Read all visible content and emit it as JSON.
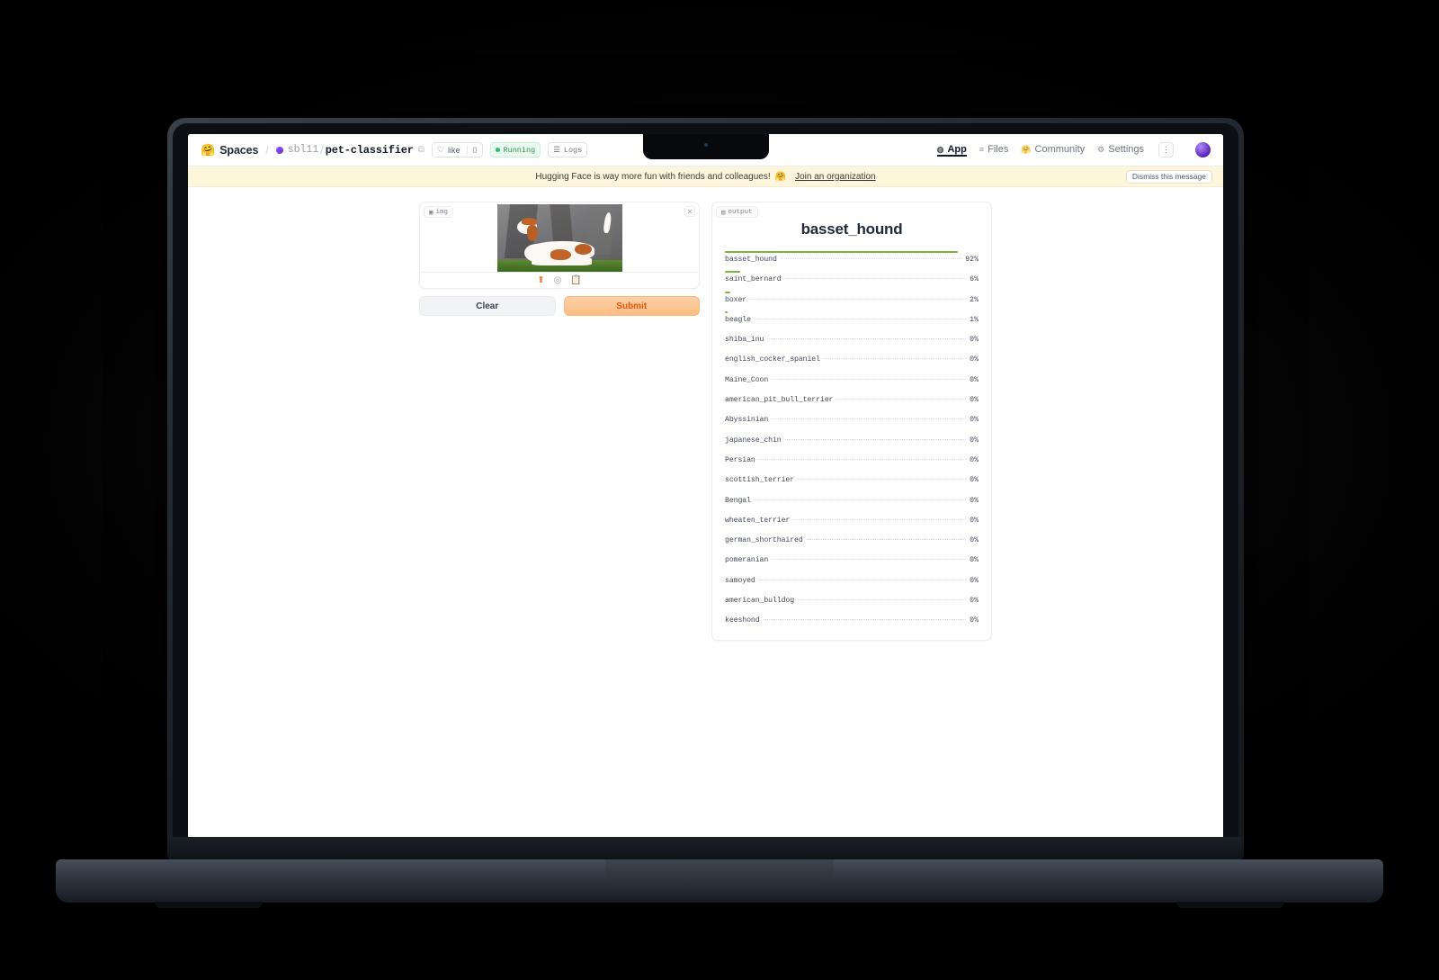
{
  "header": {
    "logo_icon": "hugging-face-emoji",
    "spaces_label": "Spaces",
    "separator": "/",
    "owner": "sbl11",
    "owner_slash": "/",
    "repo_name": "pet-classifier",
    "copy_icon": "copy-icon",
    "like_icon": "heart-icon",
    "like_label": "like",
    "like_count": "0",
    "status_label": "Running",
    "logs_icon": "logs-icon",
    "logs_label": "Logs",
    "nav": [
      {
        "icon": "app-icon",
        "label": "App",
        "active": true
      },
      {
        "icon": "files-icon",
        "label": "Files",
        "active": false
      },
      {
        "icon": "community-emoji",
        "label": "Community",
        "active": false
      },
      {
        "icon": "gear-icon",
        "label": "Settings",
        "active": false
      }
    ],
    "kebab_icon": "vertical-dots-icon",
    "avatar": "user-avatar"
  },
  "banner": {
    "message": "Hugging Face is way more fun with friends and colleagues!",
    "emoji": "🤗",
    "link_label": "Join an organization",
    "dismiss_label": "Dismiss this message"
  },
  "input_panel": {
    "badge_icon": "image-icon",
    "badge_label": "img",
    "clear_x_icon": "close-icon",
    "image_alt": "basset hound standing on grass in front of rock",
    "tools": [
      {
        "icon": "upload-icon",
        "name": "upload-image-button"
      },
      {
        "icon": "webcam-icon",
        "name": "webcam-button"
      },
      {
        "icon": "paste-icon",
        "name": "paste-clipboard-button"
      }
    ],
    "clear_label": "Clear",
    "submit_label": "Submit"
  },
  "output_panel": {
    "badge_icon": "output-icon",
    "badge_label": "output",
    "top_label": "basset_hound",
    "bar_color": "#76b83f"
  },
  "chart_data": {
    "type": "bar",
    "title": "basset_hound",
    "xlabel": "",
    "ylabel": "",
    "unit": "%",
    "categories": [
      "basset_hound",
      "saint_bernard",
      "boxer",
      "beagle",
      "shiba_inu",
      "english_cocker_spaniel",
      "Maine_Coon",
      "american_pit_bull_terrier",
      "Abyssinian",
      "japanese_chin",
      "Persian",
      "scottish_terrier",
      "Bengal",
      "wheaten_terrier",
      "german_shorthaired",
      "pomeranian",
      "samoyed",
      "american_bulldog",
      "keeshond"
    ],
    "values": [
      92,
      6,
      2,
      1,
      0,
      0,
      0,
      0,
      0,
      0,
      0,
      0,
      0,
      0,
      0,
      0,
      0,
      0,
      0
    ],
    "labels": [
      "92%",
      "6%",
      "2%",
      "1%",
      "0%",
      "0%",
      "0%",
      "0%",
      "0%",
      "0%",
      "0%",
      "0%",
      "0%",
      "0%",
      "0%",
      "0%",
      "0%",
      "0%",
      "0%"
    ],
    "ylim": [
      0,
      100
    ],
    "grid": false,
    "legend": "none",
    "orientation": "horizontal"
  }
}
